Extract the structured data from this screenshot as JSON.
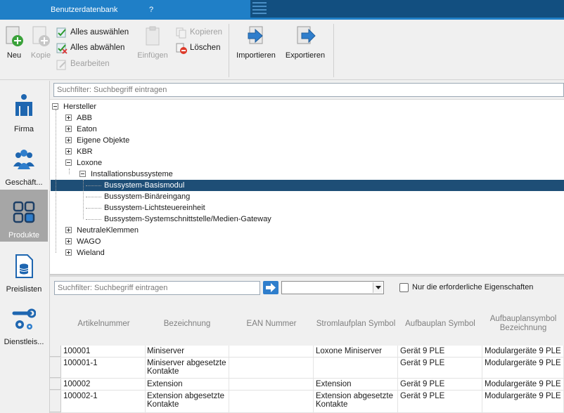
{
  "tabs": {
    "user_db": "Benutzerdatenbank",
    "help": "?"
  },
  "ribbon": {
    "new": "Neu",
    "copy_item": "Kopie",
    "select_all": "Alles auswählen",
    "deselect_all": "Alles abwählen",
    "edit": "Bearbeiten",
    "paste": "Einfügen",
    "copy": "Kopieren",
    "delete": "Löschen",
    "import": "Importieren",
    "export": "Exportieren"
  },
  "nav": [
    {
      "label": "Firma",
      "icon": "company-icon"
    },
    {
      "label": "Geschäft...",
      "icon": "business-partners-icon"
    },
    {
      "label": "Produkte",
      "icon": "products-icon"
    },
    {
      "label": "Preislisten",
      "icon": "pricelists-icon"
    },
    {
      "label": "Dienstleis...",
      "icon": "services-icon"
    }
  ],
  "search_top": {
    "placeholder": "Suchfilter: Suchbegriff eintragen"
  },
  "tree": {
    "root": "Hersteller",
    "manufacturers": [
      "ABB",
      "Eaton",
      "Eigene Objekte",
      "KBR",
      "Loxone",
      "NeutraleKlemmen",
      "WAGO",
      "Wieland"
    ],
    "loxone_group": "Installationsbussysteme",
    "loxone_items": [
      "Bussystem-Basismodul",
      "Bussystem-Binäreingang",
      "Bussystem-Lichtsteuereinheit",
      "Bussystem-Systemschnittstelle/Medien-Gateway"
    ],
    "selected": "Bussystem-Basismodul"
  },
  "search_bottom": {
    "placeholder": "Suchfilter: Suchbegriff eintragen",
    "combo_value": ""
  },
  "only_required": {
    "label": "Nur die erforderliche Eigenschaften",
    "checked": false
  },
  "grid": {
    "columns": [
      "Artikelnummer",
      "Bezeichnung",
      "EAN Nummer",
      "Stromlaufplan Symbol",
      "Aufbauplan Symbol",
      "Aufbauplansymbol Bezeichnung"
    ],
    "rows": [
      [
        "100001",
        "Miniserver",
        "",
        "Loxone Miniserver",
        "Gerät 9 PLE",
        "Modulargeräte 9 PLE"
      ],
      [
        "100001-1",
        "Miniserver abgesetzte Kontakte",
        "",
        "",
        "Gerät 9 PLE",
        "Modulargeräte 9 PLE"
      ],
      [
        "100002",
        "Extension",
        "",
        "Extension",
        "Gerät 9 PLE",
        "Modulargeräte 9 PLE"
      ],
      [
        "100002-1",
        "Extension abgesetzte Kontakte",
        "",
        "Extension abgesetzte Kontakte",
        "Gerät 9 PLE",
        "Modulargeräte 9 PLE"
      ]
    ]
  },
  "colors": {
    "accent": "#1f7fc7",
    "selection": "#1e4e76",
    "nav_active": "#a6a6a6"
  }
}
